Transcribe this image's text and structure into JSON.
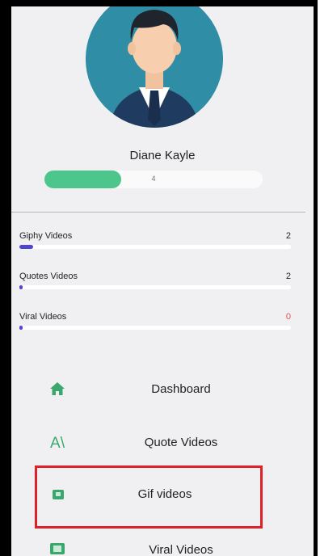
{
  "profile": {
    "name": "Diane Kayle",
    "level": "4",
    "level_progress": 0.35
  },
  "stats": [
    {
      "label": "Giphy Videos",
      "count": "2",
      "progress": 0.05
    },
    {
      "label": "Quotes Videos",
      "count": "2",
      "progress": 0.0
    },
    {
      "label": "Viral Videos",
      "count": "0",
      "progress": 0.01
    }
  ],
  "nav": [
    {
      "label": "Dashboard",
      "icon": "home-icon"
    },
    {
      "label": "Quote Videos",
      "icon": "font-icon",
      "glyph": "A\\"
    },
    {
      "label": "Gif videos",
      "icon": "calendar-icon",
      "selected": true
    },
    {
      "label": "Viral Videos",
      "icon": "film-icon"
    }
  ],
  "colors": {
    "accent_green": "#4cc68a",
    "progress_blue": "#5146c9",
    "selection_red": "#e02027",
    "avatar_bg": "#2f8da6"
  }
}
